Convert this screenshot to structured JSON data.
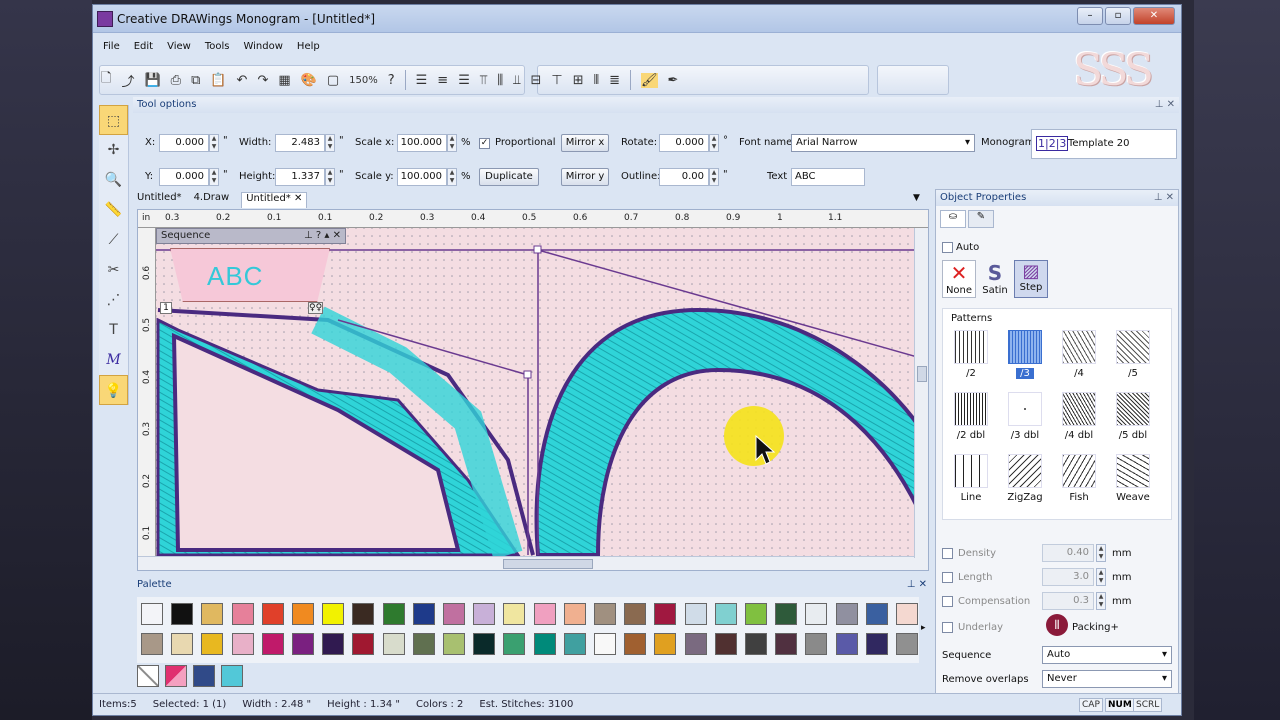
{
  "window": {
    "title": "Creative DRAWings Monogram - [Untitled*]"
  },
  "menu": [
    "File",
    "Edit",
    "View",
    "Tools",
    "Window",
    "Help"
  ],
  "toolbar": {
    "zoom": "150%"
  },
  "tool_options": {
    "title": "Tool options",
    "x_label": "X:",
    "x_value": "0.000",
    "y_label": "Y:",
    "y_value": "0.000",
    "width_label": "Width:",
    "width_value": "2.483",
    "height_label": "Height:",
    "height_value": "1.337",
    "scalex_label": "Scale x:",
    "scalex_value": "100.000",
    "scaley_label": "Scale y:",
    "scaley_value": "100.000",
    "unit_in": "\"",
    "unit_pct": "%",
    "proportional_label": "Proportional",
    "duplicate_label": "Duplicate",
    "mirrorx_label": "Mirror x",
    "mirrory_label": "Mirror y",
    "rotate_label": "Rotate:",
    "rotate_value": "0.000",
    "outline_label": "Outline:",
    "outline_value": "0.00",
    "fontname_label": "Font name",
    "fontname_value": "Arial Narrow",
    "text_label": "Text",
    "text_value": "ABC",
    "monogram_label": "Monogram",
    "template_label": "Template 20"
  },
  "tabs": [
    "Untitled*",
    "4.Draw",
    "Untitled*"
  ],
  "ruler_top": [
    "in",
    "0.3",
    "0.2",
    "0.1",
    "0.1",
    "0.2",
    "0.3",
    "0.4",
    "0.5",
    "0.6",
    "0.7",
    "0.8",
    "0.9",
    "1",
    "1.1"
  ],
  "ruler_left": [
    "0.6",
    "0.5",
    "0.4",
    "0.3",
    "0.2",
    "0.1"
  ],
  "sequence": {
    "title": "Sequence",
    "item_text": "ABC",
    "index": "1"
  },
  "palette": {
    "title": "Palette",
    "row1": [
      "#f3f4f8",
      "#111111",
      "#e0b860",
      "#e6809a",
      "#e0402a",
      "#f08a20",
      "#f2f200",
      "#3a2a22",
      "#2e7a2e",
      "#1e3a8a",
      "#c070a0",
      "#c8b0d8",
      "#f0e6a0",
      "#f0a0c0",
      "#f0b090",
      "#a09080",
      "#8a6a50",
      "#a01840",
      "#d0dce8",
      "#80d0d0",
      "#80c040",
      "#2e5a3a",
      "#e8ecf0",
      "#9090a0",
      "#3a60a0",
      "#f4d8d0"
    ],
    "row2": [
      "#a89888",
      "#e8d8b0",
      "#e8b820",
      "#e8b0c8",
      "#c01a6a",
      "#7a2080",
      "#301a50",
      "#a01830",
      "#d8dccc",
      "#607050",
      "#a8c070",
      "#0a2a2a",
      "#3aa070",
      "#008a7a",
      "#40a0a0",
      "#f8f8f8",
      "#a06030",
      "#e0a020",
      "#7a6a80",
      "#503030",
      "#404040",
      "#503040",
      "#8a8a8a",
      "#5a5aa8",
      "#302860",
      "#909090"
    ]
  },
  "object_properties": {
    "title": "Object Properties",
    "auto_label": "Auto",
    "types": [
      "None",
      "Satin",
      "Step"
    ],
    "patterns_label": "Patterns",
    "patterns": [
      "/2",
      "/3",
      "/4",
      "/5",
      "/2 dbl",
      "/3 dbl",
      "/4 dbl",
      "/5 dbl",
      "Line",
      "ZigZag",
      "Fish",
      "Weave"
    ],
    "density_label": "Density",
    "density_value": "0.40",
    "length_label": "Length",
    "length_value": "3.0",
    "compensation_label": "Compensation",
    "compensation_value": "0.3",
    "unit_mm": "mm",
    "underlay_label": "Underlay",
    "packing_label": "Packing+",
    "sequence_label": "Sequence",
    "sequence_value": "Auto",
    "remove_overlaps_label": "Remove overlaps",
    "remove_overlaps_value": "Never"
  },
  "status": {
    "items": "Items:5",
    "selected": "Selected: 1 (1)",
    "width": "Width : 2.48 \"",
    "height": "Height : 1.34 \"",
    "colors": "Colors : 2",
    "stitches": "Est. Stitches: 3100",
    "cap": "CAP",
    "num": "NUM",
    "scrl": "SCRL"
  }
}
